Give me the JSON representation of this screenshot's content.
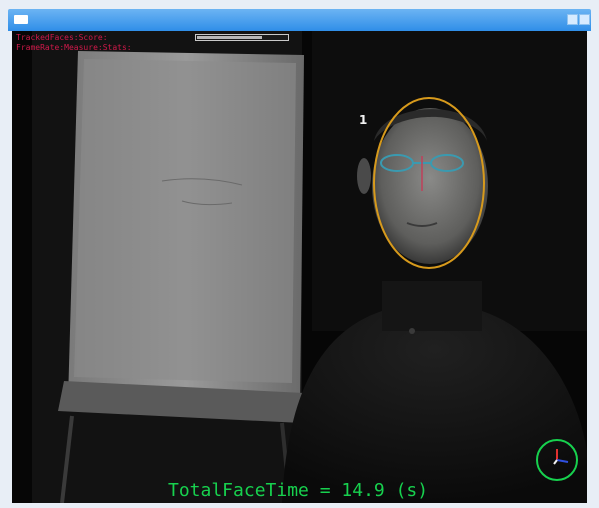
{
  "window": {
    "title": "",
    "app_icon": "window-icon",
    "controls": [
      "minimize-icon",
      "close-icon"
    ],
    "accent": "#3a97ec"
  },
  "hud": {
    "line1": "TrackedFaces:Score:",
    "line2": "FrameRate:Measure:Stats:",
    "text_color": "#d0194a",
    "progress_fraction": 0.72
  },
  "face": {
    "id_label": "1",
    "ellipse_color": "#d79a1c"
  },
  "status": {
    "total_face_time": "TotalFaceTime = 14.9 (s)",
    "color": "#17d14e"
  },
  "pose_gauge": {
    "icon": "head-pose-gauge-icon",
    "ring_color": "#17d14e"
  }
}
